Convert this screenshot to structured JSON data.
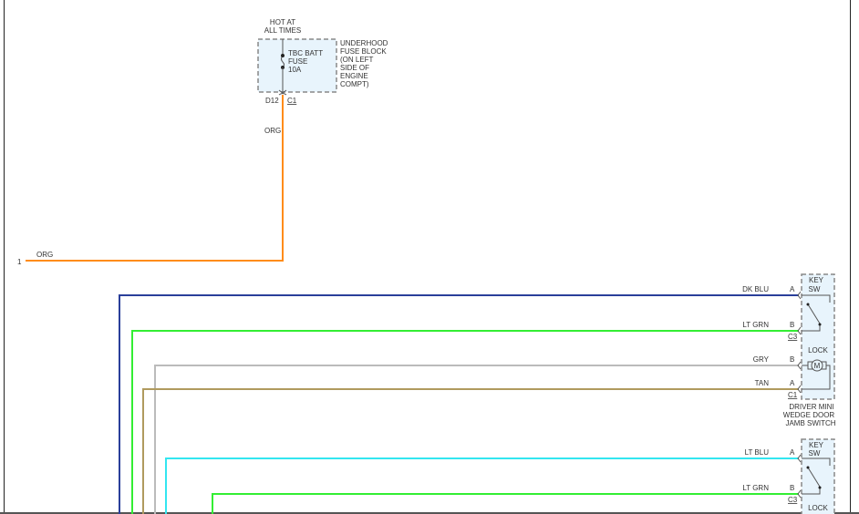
{
  "fuse_block": {
    "hot_label": [
      "HOT AT",
      "ALL TIMES"
    ],
    "fuse_label": [
      "TBC BATT",
      "FUSE",
      "10A"
    ],
    "block_label": [
      "UNDERHOOD",
      "FUSE BLOCK",
      "(ON LEFT",
      "SIDE OF",
      "ENGINE",
      "COMPT)"
    ],
    "pin": "D12",
    "connector": "C1"
  },
  "wires": {
    "org_vertical": {
      "label": "ORG",
      "color": "#ff8c1a"
    },
    "org_horizontal": {
      "label": "ORG",
      "color": "#ff8c1a",
      "ref": "1"
    },
    "dk_blu": {
      "label": "DK BLU",
      "pin": "A",
      "color": "#2a3f9a"
    },
    "lt_grn_1": {
      "label": "LT GRN",
      "pin": "B",
      "connector": "C3",
      "color": "#33ee33"
    },
    "gry": {
      "label": "GRY",
      "pin": "B",
      "color": "#bbbbbb"
    },
    "tan": {
      "label": "TAN",
      "pin": "A",
      "connector": "C1",
      "color": "#b09a5e"
    },
    "lt_blu": {
      "label": "LT BLU",
      "pin": "A",
      "color": "#33e6f0"
    },
    "lt_grn_2": {
      "label": "LT GRN",
      "pin": "B",
      "connector": "C3",
      "color": "#33ee33"
    }
  },
  "switch_1": {
    "key_sw": [
      "KEY",
      "SW"
    ],
    "lock": "LOCK",
    "motor": "M",
    "name": [
      "DRIVER MINI",
      "WEDGE DOOR",
      "JAMB SWITCH"
    ]
  },
  "switch_2": {
    "key_sw": [
      "KEY",
      "SW"
    ],
    "lock": "LOCK"
  },
  "colors": {
    "component_fill": "#e8f4fc",
    "component_border": "#888888"
  }
}
